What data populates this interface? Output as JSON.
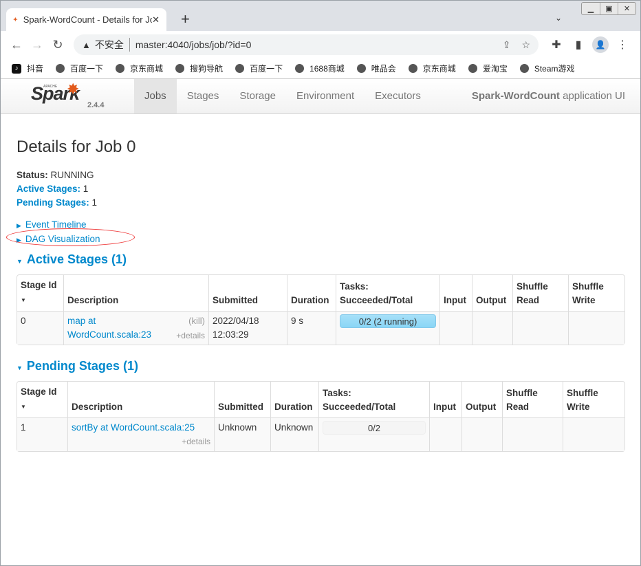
{
  "browser": {
    "tab_title": "Spark-WordCount - Details for Job 0",
    "insecure_label": "不安全",
    "url": "master:4040/jobs/job/?id=0",
    "bookmarks": [
      "抖音",
      "百度一下",
      "京东商城",
      "搜狗导航",
      "百度一下",
      "1688商城",
      "唯品会",
      "京东商城",
      "爱淘宝",
      "Steam游戏"
    ]
  },
  "navbar": {
    "logo_text": "Spark",
    "version": "2.4.4",
    "tabs": [
      "Jobs",
      "Stages",
      "Storage",
      "Environment",
      "Executors"
    ],
    "active_tab": "Jobs",
    "app_name_bold": "Spark-WordCount",
    "app_name_rest": " application UI"
  },
  "page": {
    "title": "Details for Job 0",
    "status_label": "Status:",
    "status_value": " RUNNING",
    "active_label": "Active Stages:",
    "active_value": " 1",
    "pending_label": "Pending Stages:",
    "pending_value": " 1",
    "event_timeline": "Event Timeline",
    "dag_visualization": "DAG Visualization"
  },
  "active_stages": {
    "heading": "Active Stages (1)",
    "headers": [
      "Stage Id",
      "Description",
      "Submitted",
      "Duration",
      "Tasks: Succeeded/Total",
      "Input",
      "Output",
      "Shuffle Read",
      "Shuffle Write"
    ],
    "rows": [
      {
        "id": "0",
        "desc": "map at WordCount.scala:23",
        "kill": "(kill)",
        "details": "+details",
        "submitted": "2022/04/18 12:03:29",
        "duration": "9 s",
        "tasks": "0/2 (2 running)",
        "input": "",
        "output": "",
        "shuffle_read": "",
        "shuffle_write": ""
      }
    ]
  },
  "pending_stages": {
    "heading": "Pending Stages (1)",
    "headers": [
      "Stage Id",
      "Description",
      "Submitted",
      "Duration",
      "Tasks: Succeeded/Total",
      "Input",
      "Output",
      "Shuffle Read",
      "Shuffle Write"
    ],
    "rows": [
      {
        "id": "1",
        "desc": "sortBy at WordCount.scala:25",
        "details": "+details",
        "submitted": "Unknown",
        "duration": "Unknown",
        "tasks": "0/2",
        "input": "",
        "output": "",
        "shuffle_read": "",
        "shuffle_write": ""
      }
    ]
  },
  "colors": {
    "link": "#0088cc",
    "running_bar": "#8ad6f6",
    "annotation": "#e33333"
  }
}
